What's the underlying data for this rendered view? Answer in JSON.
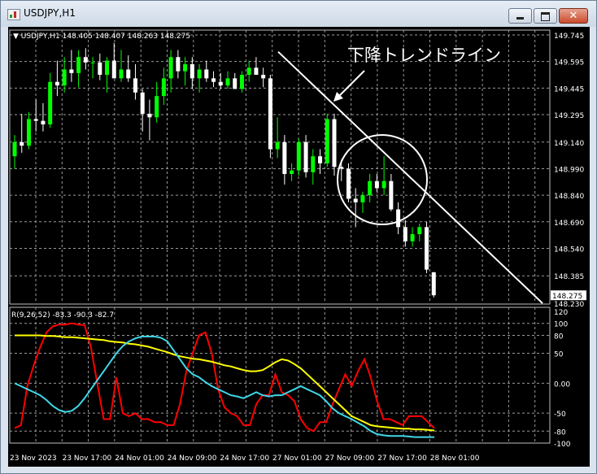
{
  "window": {
    "title": "USDJPY,H1",
    "minimize_icon": "minimize-icon",
    "maximize_icon": "maximize-icon",
    "close_icon": "close-icon"
  },
  "colors": {
    "background": "#000000",
    "grid": "#9a9a9a",
    "bull_candle": "#00ff00",
    "bear_candle": "#ffffff",
    "trendline": "#ffffff",
    "red_line": "#ff0000",
    "yellow_line": "#ffff00",
    "cyan_line": "#40d8e8",
    "price_label_bg": "#ffffff"
  },
  "main_chart": {
    "info": "USDJPY,H1  148.405 148.407 148.263 148.275",
    "price_axis": [
      "149.745",
      "149.595",
      "149.445",
      "149.295",
      "149.140",
      "148.990",
      "148.840",
      "148.690",
      "148.540",
      "148.385",
      "148.230"
    ],
    "current_price": "148.275",
    "annotation": "下降トレンドライン"
  },
  "sub_chart": {
    "info": "R(9,26,52) -83.3 -90.3 -82.7",
    "scale": [
      "120",
      "100",
      "80",
      "50",
      "0.00",
      "-50",
      "-80",
      "-100"
    ]
  },
  "time_axis": [
    "23 Nov 2023",
    "23 Nov 17:00",
    "24 Nov 01:00",
    "24 Nov 09:00",
    "24 Nov 17:00",
    "27 Nov 01:00",
    "27 Nov 09:00",
    "27 Nov 17:00",
    "28 Nov 01:00"
  ],
  "chart_data": [
    {
      "type": "candlestick",
      "symbol": "USDJPY",
      "timeframe": "H1",
      "ylim": [
        148.23,
        149.745
      ],
      "candles": [
        {
          "o": 149.06,
          "h": 149.18,
          "l": 148.99,
          "c": 149.14
        },
        {
          "o": 149.14,
          "h": 149.3,
          "l": 149.08,
          "c": 149.12
        },
        {
          "o": 149.12,
          "h": 149.31,
          "l": 149.1,
          "c": 149.27
        },
        {
          "o": 149.27,
          "h": 149.38,
          "l": 149.2,
          "c": 149.26
        },
        {
          "o": 149.26,
          "h": 149.36,
          "l": 149.2,
          "c": 149.24
        },
        {
          "o": 149.24,
          "h": 149.53,
          "l": 149.22,
          "c": 149.48
        },
        {
          "o": 149.48,
          "h": 149.6,
          "l": 149.4,
          "c": 149.46
        },
        {
          "o": 149.46,
          "h": 149.62,
          "l": 149.42,
          "c": 149.55
        },
        {
          "o": 149.55,
          "h": 149.66,
          "l": 149.48,
          "c": 149.53
        },
        {
          "o": 149.53,
          "h": 149.66,
          "l": 149.45,
          "c": 149.62
        },
        {
          "o": 149.62,
          "h": 149.67,
          "l": 149.55,
          "c": 149.59
        },
        {
          "o": 149.59,
          "h": 149.62,
          "l": 149.5,
          "c": 149.59
        },
        {
          "o": 149.59,
          "h": 149.64,
          "l": 149.49,
          "c": 149.52
        },
        {
          "o": 149.52,
          "h": 149.62,
          "l": 149.42,
          "c": 149.6
        },
        {
          "o": 149.6,
          "h": 149.7,
          "l": 149.5,
          "c": 149.5
        },
        {
          "o": 149.5,
          "h": 149.66,
          "l": 149.48,
          "c": 149.55
        },
        {
          "o": 149.55,
          "h": 149.63,
          "l": 149.48,
          "c": 149.5
        },
        {
          "o": 149.5,
          "h": 149.58,
          "l": 149.38,
          "c": 149.42
        },
        {
          "o": 149.42,
          "h": 149.44,
          "l": 149.2,
          "c": 149.3
        },
        {
          "o": 149.3,
          "h": 149.38,
          "l": 149.15,
          "c": 149.28
        },
        {
          "o": 149.28,
          "h": 149.48,
          "l": 149.25,
          "c": 149.4
        },
        {
          "o": 149.4,
          "h": 149.56,
          "l": 149.35,
          "c": 149.5
        },
        {
          "o": 149.5,
          "h": 149.66,
          "l": 149.42,
          "c": 149.62
        },
        {
          "o": 149.62,
          "h": 149.66,
          "l": 149.5,
          "c": 149.54
        },
        {
          "o": 149.54,
          "h": 149.62,
          "l": 149.46,
          "c": 149.58
        },
        {
          "o": 149.58,
          "h": 149.62,
          "l": 149.44,
          "c": 149.5
        },
        {
          "o": 149.5,
          "h": 149.58,
          "l": 149.42,
          "c": 149.55
        },
        {
          "o": 149.55,
          "h": 149.6,
          "l": 149.48,
          "c": 149.5
        },
        {
          "o": 149.5,
          "h": 149.54,
          "l": 149.45,
          "c": 149.48
        },
        {
          "o": 149.48,
          "h": 149.53,
          "l": 149.44,
          "c": 149.46
        },
        {
          "o": 149.46,
          "h": 149.54,
          "l": 149.44,
          "c": 149.5
        },
        {
          "o": 149.5,
          "h": 149.53,
          "l": 149.44,
          "c": 149.44
        },
        {
          "o": 149.44,
          "h": 149.54,
          "l": 149.42,
          "c": 149.52
        },
        {
          "o": 149.52,
          "h": 149.6,
          "l": 149.48,
          "c": 149.56
        },
        {
          "o": 149.56,
          "h": 149.62,
          "l": 149.52,
          "c": 149.52
        },
        {
          "o": 149.52,
          "h": 149.56,
          "l": 149.45,
          "c": 149.5
        },
        {
          "o": 149.5,
          "h": 149.52,
          "l": 149.05,
          "c": 149.1
        },
        {
          "o": 149.1,
          "h": 149.28,
          "l": 149.05,
          "c": 149.14
        },
        {
          "o": 149.14,
          "h": 149.18,
          "l": 148.9,
          "c": 148.96
        },
        {
          "o": 148.96,
          "h": 149.02,
          "l": 148.92,
          "c": 148.98
        },
        {
          "o": 148.98,
          "h": 149.16,
          "l": 148.95,
          "c": 149.14
        },
        {
          "o": 149.14,
          "h": 149.18,
          "l": 148.94,
          "c": 148.97
        },
        {
          "o": 148.97,
          "h": 149.1,
          "l": 148.9,
          "c": 149.06
        },
        {
          "o": 149.06,
          "h": 149.1,
          "l": 148.96,
          "c": 149.02
        },
        {
          "o": 149.02,
          "h": 149.3,
          "l": 149.0,
          "c": 149.27
        },
        {
          "o": 149.27,
          "h": 149.3,
          "l": 148.95,
          "c": 149.0
        },
        {
          "o": 149.0,
          "h": 149.04,
          "l": 148.92,
          "c": 148.99
        },
        {
          "o": 148.99,
          "h": 149.02,
          "l": 148.8,
          "c": 148.82
        },
        {
          "o": 148.82,
          "h": 148.88,
          "l": 148.66,
          "c": 148.8
        },
        {
          "o": 148.8,
          "h": 148.86,
          "l": 148.74,
          "c": 148.84
        },
        {
          "o": 148.84,
          "h": 148.96,
          "l": 148.8,
          "c": 148.92
        },
        {
          "o": 148.92,
          "h": 148.96,
          "l": 148.86,
          "c": 148.88
        },
        {
          "o": 148.88,
          "h": 149.06,
          "l": 148.84,
          "c": 148.92
        },
        {
          "o": 148.92,
          "h": 148.96,
          "l": 148.75,
          "c": 148.76
        },
        {
          "o": 148.76,
          "h": 148.8,
          "l": 148.62,
          "c": 148.66
        },
        {
          "o": 148.66,
          "h": 148.7,
          "l": 148.55,
          "c": 148.58
        },
        {
          "o": 148.58,
          "h": 148.66,
          "l": 148.55,
          "c": 148.62
        },
        {
          "o": 148.62,
          "h": 148.68,
          "l": 148.58,
          "c": 148.66
        },
        {
          "o": 148.66,
          "h": 148.69,
          "l": 148.4,
          "c": 148.42
        },
        {
          "o": 148.405,
          "h": 148.407,
          "l": 148.263,
          "c": 148.275
        }
      ],
      "trendline": {
        "points": [
          [
            149.65
          ],
          [
            148.23
          ]
        ]
      }
    },
    {
      "type": "line",
      "title": "R(9,26,52)",
      "values_current": [
        -83.3,
        -90.3,
        -82.7
      ],
      "ylim": [
        -100,
        120
      ],
      "series": [
        {
          "color": "red",
          "values": [
            -75,
            -70,
            -5,
            30,
            60,
            85,
            95,
            98,
            98,
            100,
            98,
            97,
            60,
            0,
            -60,
            -60,
            10,
            -50,
            -55,
            -50,
            -60,
            -60,
            -65,
            -65,
            -70,
            -70,
            -35,
            20,
            50,
            80,
            85,
            50,
            -10,
            -40,
            -50,
            -55,
            -70,
            -70,
            -35,
            -20,
            -20,
            15,
            -15,
            -20,
            -30,
            -60,
            -75,
            -80,
            -65,
            -65,
            -35,
            -10,
            15,
            -5,
            20,
            40,
            10,
            -30,
            -60,
            -60,
            -65,
            -70,
            -55,
            -55,
            -55,
            -65,
            -75
          ]
        },
        {
          "color": "yellow",
          "values": [
            80,
            80,
            80,
            80,
            80,
            79,
            79,
            78,
            77,
            77,
            76,
            75,
            74,
            73,
            72,
            70,
            69,
            68,
            66,
            65,
            63,
            61,
            58,
            55,
            52,
            48,
            45,
            43,
            41,
            40,
            38,
            36,
            33,
            30,
            28,
            25,
            22,
            20,
            20,
            22,
            28,
            35,
            40,
            38,
            32,
            25,
            15,
            5,
            -5,
            -15,
            -25,
            -35,
            -45,
            -55,
            -60,
            -65,
            -70,
            -72,
            -73,
            -74,
            -75,
            -76,
            -76,
            -77,
            -77,
            -78,
            -79
          ]
        },
        {
          "color": "cyan",
          "values": [
            0,
            -5,
            -10,
            -15,
            -20,
            -28,
            -38,
            -45,
            -48,
            -46,
            -38,
            -25,
            -10,
            5,
            20,
            35,
            50,
            62,
            70,
            75,
            78,
            78,
            78,
            76,
            70,
            55,
            40,
            25,
            15,
            10,
            2,
            -5,
            -10,
            -15,
            -20,
            -22,
            -25,
            -20,
            -15,
            -20,
            -22,
            -20,
            -20,
            -15,
            -10,
            -5,
            -10,
            -15,
            -20,
            -30,
            -42,
            -50,
            -55,
            -60,
            -66,
            -72,
            -80,
            -85,
            -87,
            -88,
            -88,
            -88,
            -89,
            -90,
            -90,
            -90,
            -90
          ]
        }
      ]
    }
  ]
}
